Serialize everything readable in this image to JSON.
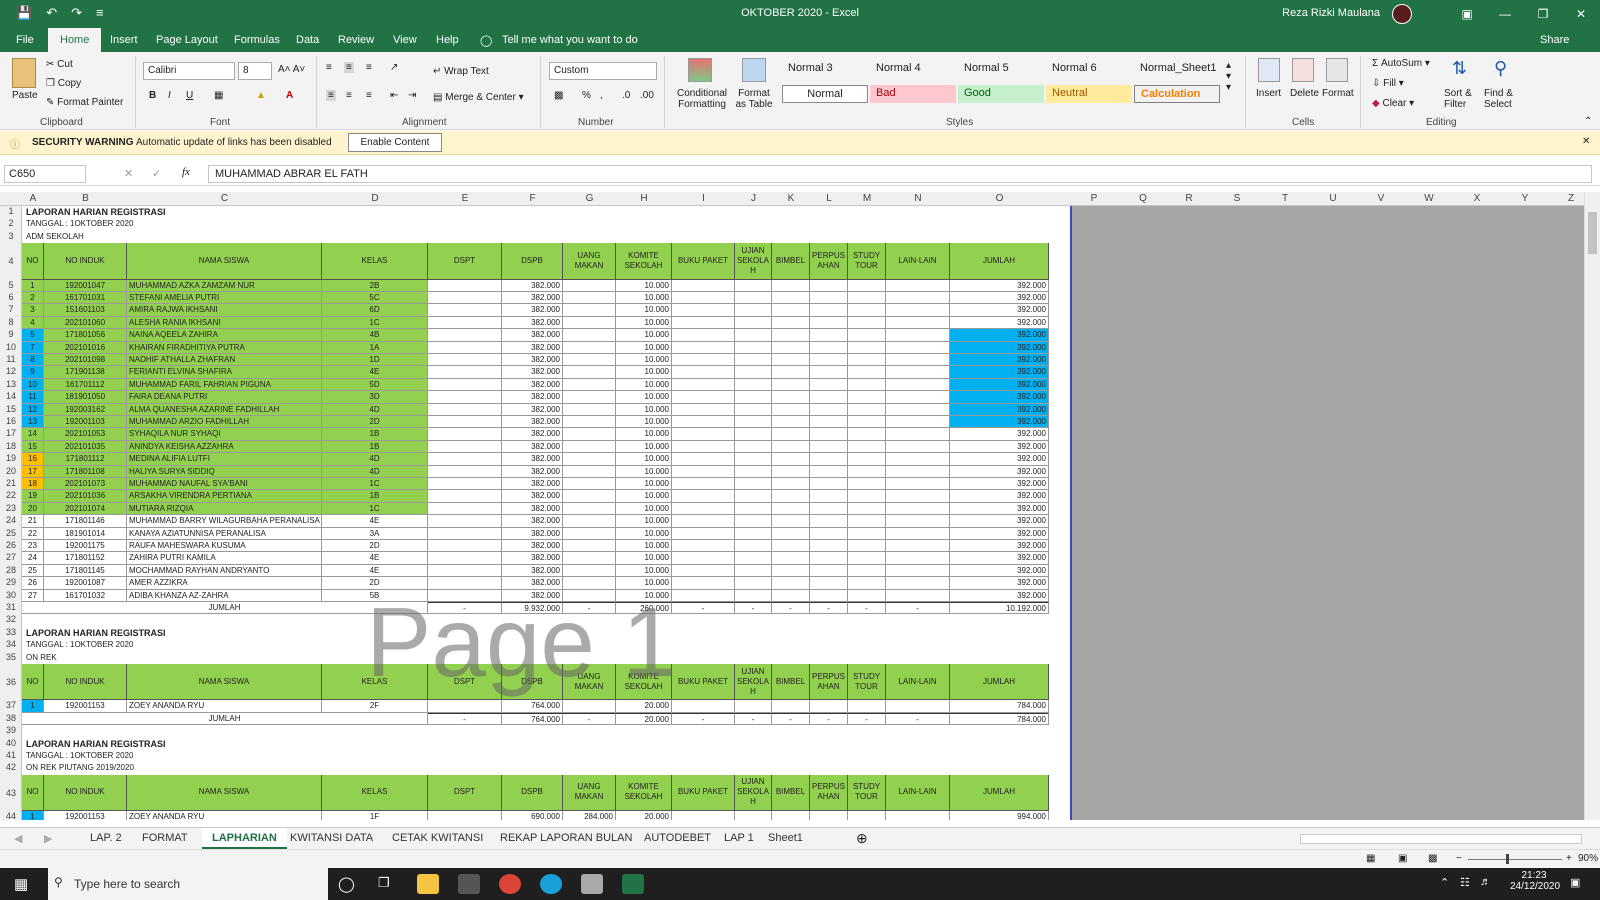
{
  "window": {
    "title": "OKTOBER 2020  -  Excel",
    "user": "Reza Rizki Maulana"
  },
  "ribbon_tabs": [
    "File",
    "Home",
    "Insert",
    "Page Layout",
    "Formulas",
    "Data",
    "Review",
    "View",
    "Help",
    "Tell me what you want to do"
  ],
  "share": "Share",
  "clipboard": {
    "paste": "Paste",
    "cut": "Cut",
    "copy": "Copy",
    "format_painter": "Format Painter",
    "label": "Clipboard"
  },
  "font": {
    "name": "Calibri",
    "size": "8",
    "label": "Font"
  },
  "alignment": {
    "wrap": "Wrap Text",
    "merge": "Merge & Center",
    "label": "Alignment"
  },
  "number": {
    "format": "Custom",
    "label": "Number"
  },
  "styles": {
    "cond": "Conditional Formatting",
    "table": "Format as Table",
    "items_top": [
      "Normal 3",
      "Normal 4",
      "Normal 5",
      "Normal 6",
      "Normal_Sheet1"
    ],
    "items_bottom": [
      "Normal",
      "Bad",
      "Good",
      "Neutral",
      "Calculation"
    ],
    "label": "Styles"
  },
  "cells_grp": {
    "insert": "Insert",
    "delete": "Delete",
    "format": "Format",
    "label": "Cells"
  },
  "editing": {
    "autosum": "AutoSum",
    "fill": "Fill",
    "clear": "Clear",
    "sort": "Sort & Filter",
    "find": "Find & Select",
    "label": "Editing"
  },
  "security": {
    "title": "SECURITY WARNING",
    "message": "Automatic update of links has been disabled",
    "button": "Enable Content"
  },
  "formula_bar": {
    "name_box": "C650",
    "fx": "fx",
    "value": "MUHAMMAD ABRAR EL FATH"
  },
  "columns": [
    "A",
    "B",
    "C",
    "D",
    "E",
    "F",
    "G",
    "H",
    "I",
    "J",
    "K",
    "L",
    "M",
    "N",
    "O",
    "P",
    "Q",
    "R",
    "S",
    "T",
    "U",
    "V",
    "W",
    "X",
    "Y",
    "Z"
  ],
  "report": {
    "title": "LAPORAN HARIAN REGISTRASI",
    "date": "TANGGAL : 1OKTOBER 2020",
    "section1": "ADM SEKOLAH",
    "section2": "ON REK",
    "section3": "ON REK PIUTANG 2019/2020",
    "headers": [
      "NO",
      "NO INDUK",
      "NAMA SISWA",
      "KELAS",
      "DSPT",
      "DSPB",
      "UANG MAKAN",
      "KOMITE SEKOLAH",
      "BUKU PAKET",
      "UJIAN SEKOLAH",
      "BIMBEL",
      "PERPUSTAKAAN",
      "STUDY TOUR",
      "LAIN-LAIN",
      "JUMLAH"
    ],
    "headers_wrapped": [
      "NO",
      "NO INDUK",
      "NAMA SISWA",
      "KELAS",
      "DSPT",
      "DSPB",
      "UANG\nMAKAN",
      "KOMITE\nSEKOLAH",
      "BUKU PAKET",
      "UJIAN\nSEKOLA\nH",
      "BIMBEL",
      "PERPUS\nAHAN",
      "STUDY\nTOUR",
      "LAIN-LAIN",
      "JUMLAH"
    ],
    "rows": [
      [
        "1",
        "192001047",
        "MUHAMMAD AZKA ZAMZAM NUR",
        "2B",
        "",
        "382.000",
        "",
        "10.000",
        "",
        "",
        "",
        "",
        "",
        "",
        "392.000"
      ],
      [
        "2",
        "161701031",
        "STEFANI AMELIA PUTRI",
        "5C",
        "",
        "382.000",
        "",
        "10.000",
        "",
        "",
        "",
        "",
        "",
        "",
        "392.000"
      ],
      [
        "3",
        "151601103",
        "AMIRA RAJWA IKHSANI",
        "6D",
        "",
        "382.000",
        "",
        "10.000",
        "",
        "",
        "",
        "",
        "",
        "",
        "392.000"
      ],
      [
        "4",
        "202101060",
        "ALESHA RANIA IKHSANI",
        "1C",
        "",
        "382.000",
        "",
        "10.000",
        "",
        "",
        "",
        "",
        "",
        "",
        "392.000"
      ],
      [
        "5",
        "171801056",
        "NAINA AQEELA ZAHIRA",
        "4B",
        "",
        "382.000",
        "",
        "10.000",
        "",
        "",
        "",
        "",
        "",
        "",
        "392.000"
      ],
      [
        "7",
        "202101016",
        "KHAIRAN FIRADHITIYA PUTRA",
        "1A",
        "",
        "382.000",
        "",
        "10.000",
        "",
        "",
        "",
        "",
        "",
        "",
        "392.000"
      ],
      [
        "8",
        "202101098",
        "NADHIF ATHALLA ZHAFRAN",
        "1D",
        "",
        "382.000",
        "",
        "10.000",
        "",
        "",
        "",
        "",
        "",
        "",
        "392.000"
      ],
      [
        "9",
        "171901138",
        "FERIANTI ELVINA SHAFIRA",
        "4E",
        "",
        "382.000",
        "",
        "10.000",
        "",
        "",
        "",
        "",
        "",
        "",
        "392.000"
      ],
      [
        "10",
        "161701112",
        "MUHAMMAD FARIL FAHRIAN PIGUNA",
        "5D",
        "",
        "382.000",
        "",
        "10.000",
        "",
        "",
        "",
        "",
        "",
        "",
        "392.000"
      ],
      [
        "11",
        "181901050",
        "FAIRA DEANA PUTRI",
        "3D",
        "",
        "382.000",
        "",
        "10.000",
        "",
        "",
        "",
        "",
        "",
        "",
        "392.000"
      ],
      [
        "12",
        "192003162",
        "ALMA QUANESHA AZARINE FADHILLAH",
        "4D",
        "",
        "382.000",
        "",
        "10.000",
        "",
        "",
        "",
        "",
        "",
        "",
        "392.000"
      ],
      [
        "13",
        "192001103",
        "MUHAMMAD ARZIO FADHILLAH",
        "2D",
        "",
        "382.000",
        "",
        "10.000",
        "",
        "",
        "",
        "",
        "",
        "",
        "392.000"
      ],
      [
        "14",
        "202101053",
        "SYHAQILA NUR SYHAQI",
        "1B",
        "",
        "382.000",
        "",
        "10.000",
        "",
        "",
        "",
        "",
        "",
        "",
        "392.000"
      ],
      [
        "15",
        "202101035",
        "ANINDYA KEISHA AZZAHRA",
        "1B",
        "",
        "382.000",
        "",
        "10.000",
        "",
        "",
        "",
        "",
        "",
        "",
        "392.000"
      ],
      [
        "16",
        "171801112",
        "MEDINA ALIFIA LUTFI",
        "4D",
        "",
        "382.000",
        "",
        "10.000",
        "",
        "",
        "",
        "",
        "",
        "",
        "392.000"
      ],
      [
        "17",
        "171801108",
        "HALIYA SURYA SIDDIQ",
        "4D",
        "",
        "382.000",
        "",
        "10.000",
        "",
        "",
        "",
        "",
        "",
        "",
        "392.000"
      ],
      [
        "18",
        "202101073",
        "MUHAMMAD NAUFAL SYA'BANI",
        "1C",
        "",
        "382.000",
        "",
        "10.000",
        "",
        "",
        "",
        "",
        "",
        "",
        "392.000"
      ],
      [
        "19",
        "202101036",
        "ARSAKHA VIRENDRA PERTIANA",
        "1B",
        "",
        "382.000",
        "",
        "10.000",
        "",
        "",
        "",
        "",
        "",
        "",
        "392.000"
      ],
      [
        "20",
        "202101074",
        "MUTIARA RIZQIA",
        "1C",
        "",
        "382.000",
        "",
        "10.000",
        "",
        "",
        "",
        "",
        "",
        "",
        "392.000"
      ],
      [
        "21",
        "171801146",
        "MUHAMMAD BARRY WILAGURBAHA PERANALISA",
        "4E",
        "",
        "382.000",
        "",
        "10.000",
        "",
        "",
        "",
        "",
        "",
        "",
        "392.000"
      ],
      [
        "22",
        "181901014",
        "KANAYA AZIATUNNISA PERANALISA",
        "3A",
        "",
        "382.000",
        "",
        "10.000",
        "",
        "",
        "",
        "",
        "",
        "",
        "392.000"
      ],
      [
        "23",
        "192001175",
        "RAUFA MAHESWARA KUSUMA",
        "2D",
        "",
        "382.000",
        "",
        "10.000",
        "",
        "",
        "",
        "",
        "",
        "",
        "392.000"
      ],
      [
        "24",
        "171801152",
        "ZAHIRA PUTRI KAMILA",
        "4E",
        "",
        "382.000",
        "",
        "10.000",
        "",
        "",
        "",
        "",
        "",
        "",
        "392.000"
      ],
      [
        "25",
        "171801145",
        "MOCHAMMAD RAYHAN ANDRYANTO",
        "4E",
        "",
        "382.000",
        "",
        "10.000",
        "",
        "",
        "",
        "",
        "",
        "",
        "392.000"
      ],
      [
        "26",
        "192001087",
        "AMER AZZIKRA",
        "2D",
        "",
        "382.000",
        "",
        "10.000",
        "",
        "",
        "",
        "",
        "",
        "",
        "392.000"
      ],
      [
        "27",
        "161701032",
        "ADIBA KHANZA AZ-ZAHRA",
        "5B",
        "",
        "382.000",
        "",
        "10.000",
        "",
        "",
        "",
        "",
        "",
        "",
        "392.000"
      ]
    ],
    "total1": [
      "JUMLAH",
      "-",
      "9.932.000",
      "-",
      "260.000",
      "-",
      "-",
      "-",
      "-",
      "-",
      "-",
      "10.192.000"
    ],
    "row37": [
      "1",
      "192001153",
      "ZOEY ANANDA RYU",
      "2F",
      "",
      "764.000",
      "",
      "20.000",
      "",
      "",
      "",
      "",
      "",
      "",
      "784.000"
    ],
    "total2": [
      "JUMLAH",
      "-",
      "764.000",
      "-",
      "20.000",
      "-",
      "-",
      "-",
      "-",
      "-",
      "-",
      "784.000"
    ],
    "row44": [
      "1",
      "192001153",
      "ZOEY ANANDA RYU",
      "1F",
      "",
      "690.000",
      "284.000",
      "20.000",
      "",
      "",
      "",
      "",
      "",
      "",
      "994.000"
    ]
  },
  "watermark": "Page 1",
  "sheet_tabs": [
    "LAP. 2",
    "FORMAT",
    "LAPHARIAN",
    "KWITANSI DATA",
    "CETAK KWITANSI",
    "REKAP LAPORAN BULAN",
    "AUTODEBET",
    "LAP 1",
    "Sheet1"
  ],
  "active_sheet": "LAPHARIAN",
  "zoom": "90%",
  "taskbar": {
    "search": "Type here to search",
    "time": "21:23",
    "date": "24/12/2020"
  }
}
